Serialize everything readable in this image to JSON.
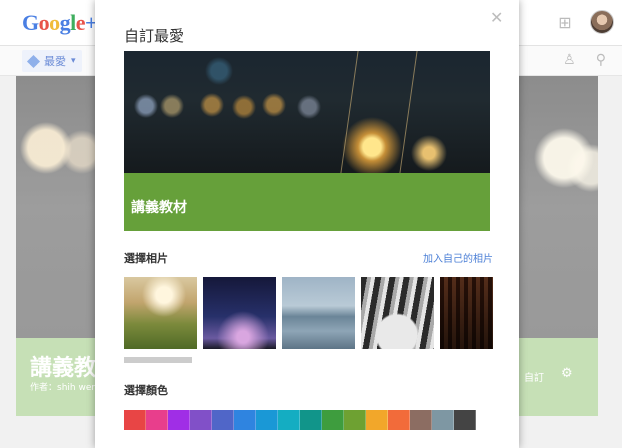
{
  "background": {
    "logo_letters": [
      {
        "ch": "G",
        "color": "#4a7fe3"
      },
      {
        "ch": "o",
        "color": "#e8534a"
      },
      {
        "ch": "o",
        "color": "#f0bc3a"
      },
      {
        "ch": "g",
        "color": "#4a7fe3"
      },
      {
        "ch": "l",
        "color": "#3fae5e"
      },
      {
        "ch": "e",
        "color": "#e8534a"
      },
      {
        "ch": "+",
        "color": "#4a7fe3"
      }
    ],
    "menu_label": "最愛",
    "cover_title": "講義教",
    "cover_author": "作者：shih wen",
    "cover_custom": "自訂",
    "icons": {
      "bell": "bell-icon",
      "add": "add-box-icon",
      "people": "people-icon",
      "share": "share-icon",
      "gear": "gear-icon"
    }
  },
  "dialog": {
    "title": "自訂最愛",
    "close_glyph": "✕",
    "preview_label": "講義教材",
    "choose_photo_label": "選擇相片",
    "add_own_photo_link": "加入自己的相片",
    "choose_color_label": "選擇顏色",
    "thumbnails": [
      "field-sunrise",
      "night-sky",
      "pier-water",
      "dome-architecture",
      "ceiling-structure"
    ],
    "colors": [
      "#e84545",
      "#e83e8c",
      "#a02ee6",
      "#8150c8",
      "#5066c8",
      "#2f84e0",
      "#1a98d6",
      "#14adc2",
      "#11958a",
      "#3e9d3e",
      "#6ea132",
      "#f2a72a",
      "#f26b3a",
      "#8c6d62",
      "#7e97a3",
      "#444444"
    ]
  }
}
